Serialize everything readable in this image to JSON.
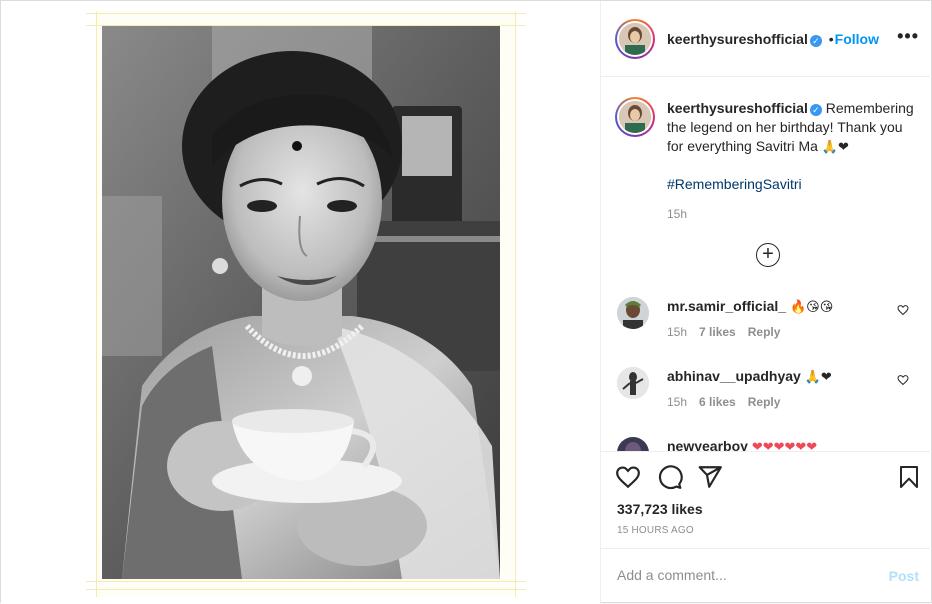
{
  "post": {
    "author": "keerthysureshofficial",
    "follow_label": "Follow",
    "follow_separator": "•",
    "more_label": "•••"
  },
  "caption": {
    "username": "keerthysureshofficial",
    "text": "Remembering the legend on her birthday! Thank you for everything Savitri Ma",
    "emojis": "🙏❤",
    "hashtag": "#RememberingSavitri",
    "time": "15h"
  },
  "comments": [
    {
      "username": "mr.samir_official_",
      "text": "",
      "emojis": "🔥😘😘",
      "time": "15h",
      "likes": "7 likes",
      "reply_label": "Reply"
    },
    {
      "username": "abhinav__upadhyay",
      "text": "",
      "emojis": "🙏❤",
      "time": "15h",
      "likes": "6 likes",
      "reply_label": "Reply"
    },
    {
      "username": "newyearboy",
      "text": "",
      "emojis": "❤❤❤❤❤❤",
      "time": "",
      "likes": "",
      "reply_label": ""
    }
  ],
  "stats": {
    "likes": "337,723 likes",
    "posted_ago": "15 HOURS AGO"
  },
  "composer": {
    "placeholder": "Add a comment...",
    "post_label": "Post"
  },
  "colors": {
    "accent": "#0095f6",
    "verified": "#3897f0",
    "heart": "#ed4956",
    "post_disabled": "#b2dffc"
  },
  "icons": {
    "load_more": "plus-circle-icon",
    "like": "heart-icon",
    "comment": "comment-bubble-icon",
    "share": "paper-plane-icon",
    "save": "bookmark-icon"
  }
}
